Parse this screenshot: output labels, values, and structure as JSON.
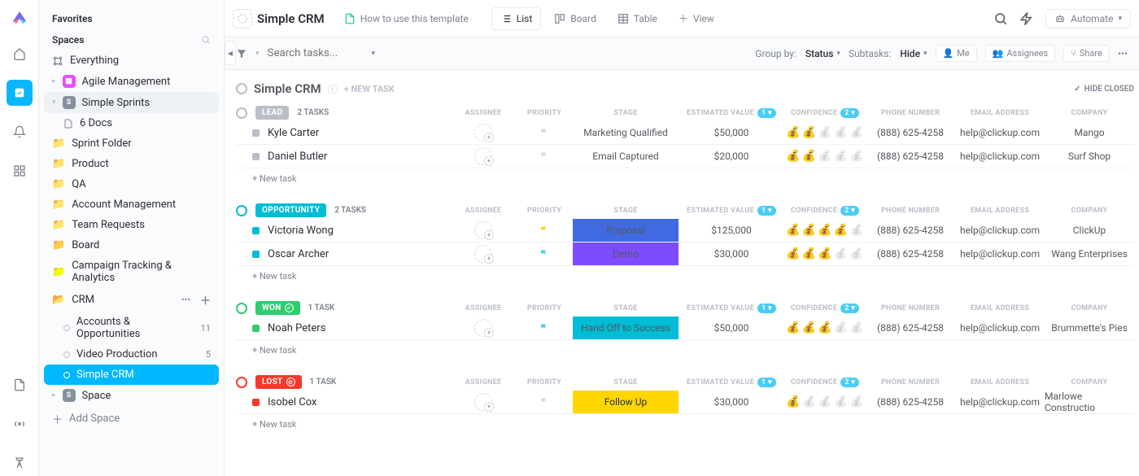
{
  "sidebar": {
    "favorites_label": "Favorites",
    "spaces_label": "Spaces",
    "everything_label": "Everything",
    "agile": "Agile Management",
    "sprints": "Simple Sprints",
    "docs": "6 Docs",
    "sprint_folder": "Sprint Folder",
    "product": "Product",
    "qa": "QA",
    "account_mgmt": "Account Management",
    "team_requests": "Team Requests",
    "board": "Board",
    "campaign": "Campaign Tracking & Analytics",
    "crm": "CRM",
    "accounts": "Accounts & Opportunities",
    "accounts_count": "11",
    "video": "Video Production",
    "video_count": "5",
    "simple_crm": "Simple CRM",
    "space": "Space",
    "add_space": "Add Space"
  },
  "header": {
    "title": "Simple CRM",
    "template_link": "How to use this template",
    "views": {
      "list": "List",
      "board": "Board",
      "table": "Table",
      "add": "View"
    },
    "automate": "Automate"
  },
  "filter": {
    "search_ph": "Search tasks...",
    "groupby_label": "Group by:",
    "groupby_value": "Status",
    "subtasks_label": "Subtasks:",
    "subtasks_value": "Hide",
    "me": "Me",
    "assignees": "Assignees",
    "share": "Share"
  },
  "list": {
    "name": "Simple CRM",
    "new_task": "+ NEW TASK",
    "hide_closed": "HIDE CLOSED"
  },
  "columns": {
    "assignee": "ASSIGNEE",
    "priority": "PRIORITY",
    "stage": "STAGE",
    "estval": "ESTIMATED VALUE",
    "conf": "CONFIDENCE",
    "phone": "PHONE NUMBER",
    "email": "EMAIL ADDRESS",
    "company": "COMPANY",
    "badge1": "1",
    "badge2": "2"
  },
  "ui": {
    "new_task_row": "+ New task"
  },
  "groups": [
    {
      "status": "LEAD",
      "style": "gray",
      "count_label": "2 TASKS",
      "has_badge": false,
      "circle_color": "#b9bec7",
      "tasks": [
        {
          "name": "Kyle Carter",
          "dot": "gray",
          "flag": "#d6dae1",
          "stage": "Marketing Qualified",
          "stage_style": "neutral",
          "estval": "$50,000",
          "conf": 2,
          "phone": "(888) 625-4258",
          "email": "help@clickup.com",
          "company": "Mango"
        },
        {
          "name": "Daniel Butler",
          "dot": "gray",
          "flag": "#d6dae1",
          "stage": "Email Captured",
          "stage_style": "neutral",
          "estval": "$20,000",
          "conf": 2,
          "phone": "(888) 625-4258",
          "email": "help@clickup.com",
          "company": "Surf Shop"
        }
      ]
    },
    {
      "status": "OPPORTUNITY",
      "style": "teal",
      "count_label": "2 TASKS",
      "has_badge": false,
      "circle_color": "#02bcd4",
      "tasks": [
        {
          "name": "Victoria Wong",
          "dot": "teal",
          "flag": "#ffd633",
          "stage": "Proposal",
          "stage_style": "blue",
          "estval": "$125,000",
          "conf": 4,
          "phone": "(888) 625-4258",
          "email": "help@clickup.com",
          "company": "ClickUp"
        },
        {
          "name": "Oscar Archer",
          "dot": "teal",
          "flag": "#49ccf9",
          "stage": "Demo",
          "stage_style": "purple",
          "estval": "$30,000",
          "conf": 3,
          "phone": "(888) 625-4258",
          "email": "help@clickup.com",
          "company": "Wang Enterprises"
        }
      ]
    },
    {
      "status": "WON",
      "style": "green",
      "count_label": "1 TASK",
      "has_badge": true,
      "circle_color": "#2ecd6f",
      "tasks": [
        {
          "name": "Noah Peters",
          "dot": "green",
          "flag": "#49ccf9",
          "stage": "Hand Off to Success",
          "stage_style": "cyan",
          "estval": "$50,000",
          "conf": 3,
          "phone": "(888) 625-4258",
          "email": "help@clickup.com",
          "company": "Brummette's Pies"
        }
      ]
    },
    {
      "status": "LOST",
      "style": "red",
      "count_label": "1 TASK",
      "has_badge": true,
      "circle_color": "#f8382a",
      "tasks": [
        {
          "name": "Isobel Cox",
          "dot": "red",
          "flag": "#d6dae1",
          "stage": "Follow Up",
          "stage_style": "yellow",
          "estval": "$30,000",
          "conf": 1,
          "phone": "(888) 625-4258",
          "email": "help@clickup.com",
          "company": "Marlowe Constructio"
        }
      ]
    }
  ]
}
